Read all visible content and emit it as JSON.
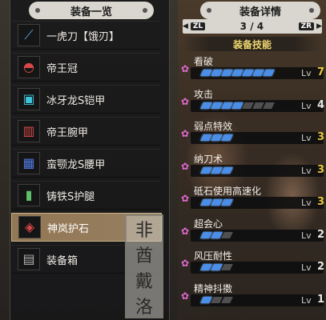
{
  "left": {
    "title": "装备一览",
    "items": [
      {
        "label": "一虎刀【饿刃】",
        "icon": "long-sword-icon",
        "glyph": "⟋",
        "color": "#56a8e6"
      },
      {
        "label": "帝王冠",
        "icon": "helmet-icon",
        "glyph": "◓",
        "color": "#d94848"
      },
      {
        "label": "冰牙龙S铠甲",
        "icon": "chest-armor-icon",
        "glyph": "▣",
        "color": "#3fc2d8"
      },
      {
        "label": "帝王腕甲",
        "icon": "arm-armor-icon",
        "glyph": "▥",
        "color": "#d94848"
      },
      {
        "label": "蛮颚龙S腰甲",
        "icon": "waist-armor-icon",
        "glyph": "▦",
        "color": "#4f7be0"
      },
      {
        "label": "铸铁S护腿",
        "icon": "leg-armor-icon",
        "glyph": "▮",
        "color": "#5fbf6a"
      },
      {
        "label": "神岚护石",
        "icon": "charm-icon",
        "glyph": "◈",
        "color": "#d94848"
      },
      {
        "label": "装备箱",
        "icon": "equipment-box-icon",
        "glyph": "▤",
        "color": "#b0b0b0"
      }
    ],
    "selected_index": 6
  },
  "right": {
    "title": "装备详情",
    "nav": {
      "left_button": "ZL",
      "right_button": "ZR",
      "page": "3 / 4"
    },
    "skills_header": "装备技能",
    "lv_label": "Lv",
    "skills": [
      {
        "name": "看破",
        "level": 7,
        "max": 7,
        "is_max": true
      },
      {
        "name": "攻击",
        "level": 4,
        "max": 7,
        "is_max": false
      },
      {
        "name": "弱点特效",
        "level": 3,
        "max": 3,
        "is_max": true
      },
      {
        "name": "纳刀术",
        "level": 3,
        "max": 3,
        "is_max": true
      },
      {
        "name": "砥石使用高速化",
        "level": 3,
        "max": 3,
        "is_max": true
      },
      {
        "name": "超会心",
        "level": 2,
        "max": 3,
        "is_max": false
      },
      {
        "name": "风压耐性",
        "level": 2,
        "max": 3,
        "is_max": false
      },
      {
        "name": "精神抖擞",
        "level": 1,
        "max": 3,
        "is_max": false
      }
    ]
  },
  "watermark": [
    "非",
    "酋",
    "戴",
    "洛"
  ],
  "colors": {
    "pip_on": "#4a8ee8",
    "pip_off": "#4f4f4f",
    "level_max": "#e9c63a",
    "skill_icon": "#e36bd4"
  }
}
